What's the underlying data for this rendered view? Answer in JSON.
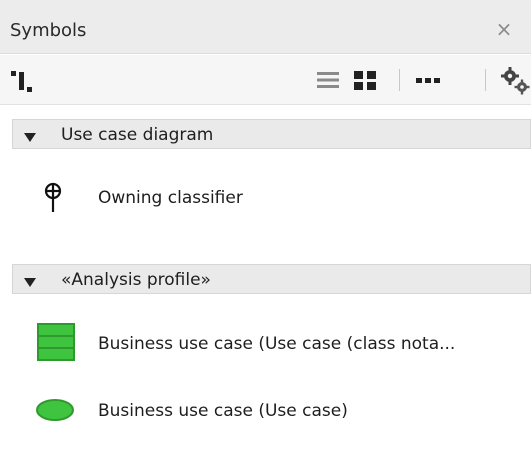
{
  "panel": {
    "title": "Symbols",
    "close_glyph": "×"
  },
  "toolbar": {
    "buttons": [
      {
        "icon": "snap-layout-icon"
      },
      {
        "icon": "list-view-icon"
      },
      {
        "icon": "grid-view-icon"
      },
      {
        "icon": "more-icon"
      },
      {
        "icon": "settings-gears-icon"
      }
    ]
  },
  "sections": [
    {
      "label": "Use case diagram",
      "items": [
        {
          "label": "Owning classifier",
          "icon": "owning-classifier-icon"
        }
      ]
    },
    {
      "label": "«Analysis profile»",
      "items": [
        {
          "label": "Business use case (Use case (class nota...",
          "icon": "class-notation-icon",
          "color": "#3fc43f"
        },
        {
          "label": "Business use case (Use case)",
          "icon": "ellipse-icon",
          "color": "#3fc43f"
        }
      ]
    }
  ],
  "colors": {
    "titlebar": "#ececec",
    "section_header": "#eaeaea",
    "green_fill": "#3fc43f",
    "green_border": "#2e9a2e",
    "icon_dark": "#222222"
  }
}
